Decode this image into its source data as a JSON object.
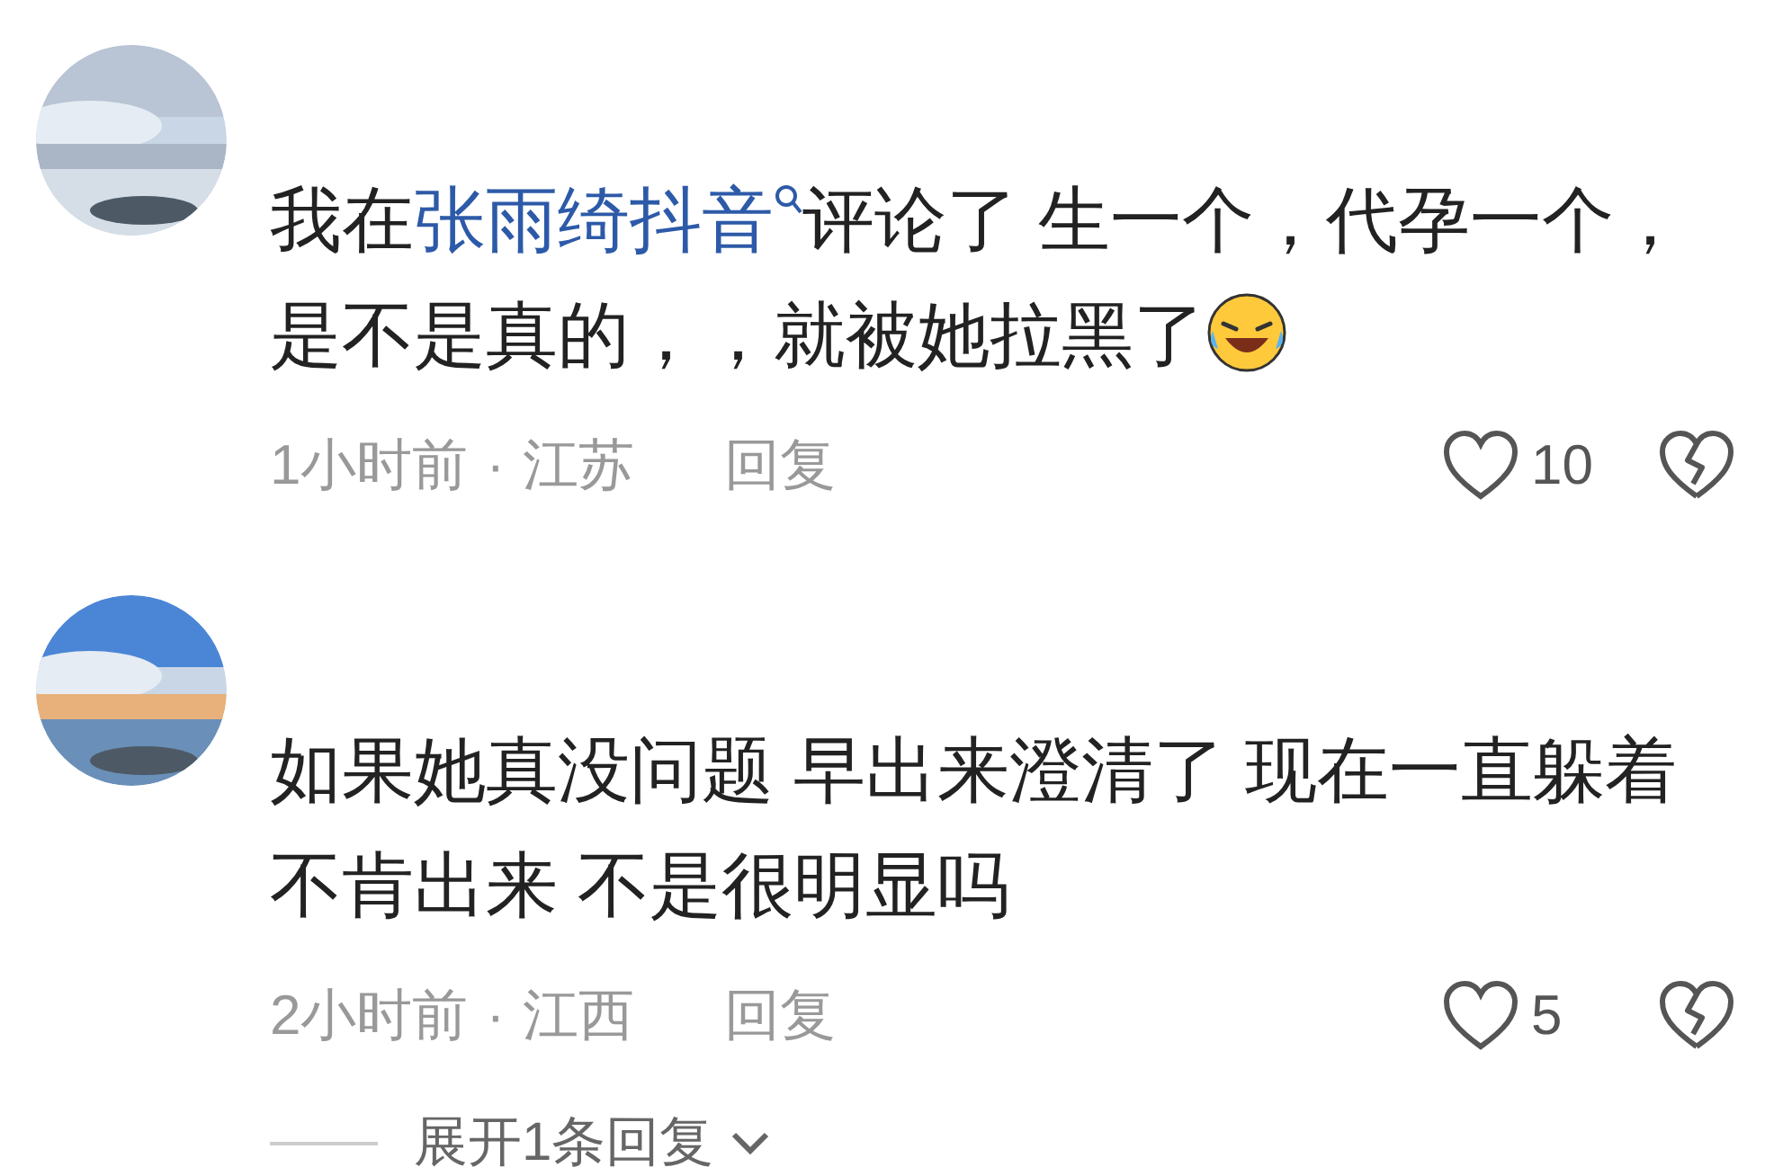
{
  "comments": [
    {
      "segments": [
        {
          "kind": "text",
          "text": "我在"
        },
        {
          "kind": "link",
          "text": "张雨绮抖音"
        },
        {
          "kind": "text",
          "text": "评论了  生一个，代孕一个，是不是真的，，就被她拉黑了"
        },
        {
          "kind": "emoji"
        }
      ],
      "time": "1小时前",
      "separator": "·",
      "location": "江苏",
      "reply": "回复",
      "likes": "10",
      "liked": false
    },
    {
      "segments": [
        {
          "kind": "text",
          "text": "如果她真没问题 早出来澄清了 现在一直躲着不肯出来 不是很明显吗"
        }
      ],
      "time": "2小时前",
      "separator": "·",
      "location": "江西",
      "reply": "回复",
      "likes": "5",
      "liked": false
    }
  ],
  "expand_replies": "展开1条回复"
}
